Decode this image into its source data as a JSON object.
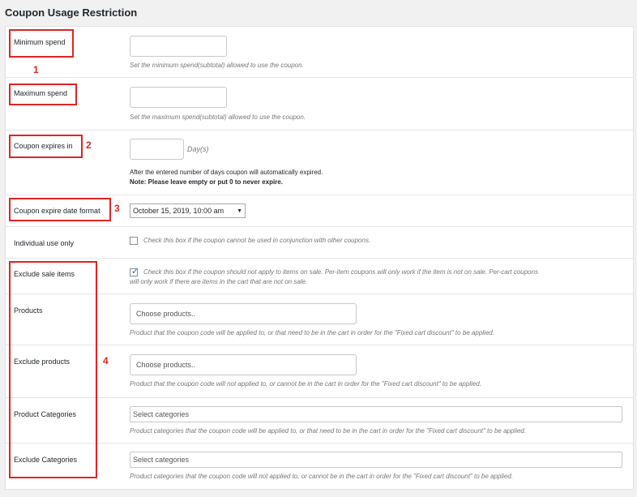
{
  "section_title": "Coupon Usage Restriction",
  "min_spend": {
    "label": "Minimum spend",
    "value": "",
    "help": "Set the minimum spend(subtotal) allowed to use the coupon."
  },
  "max_spend": {
    "label": "Maximum spend",
    "value": "",
    "help": "Set the maximum spend(subtotal) allowed to use the coupon."
  },
  "expires_in": {
    "label": "Coupon expires in",
    "value": "",
    "unit": "Day(s)",
    "help": "After the entered number of days coupon will automatically expired.",
    "note": "Note: Please leave empty or put 0 to never expire."
  },
  "date_format": {
    "label": "Coupon expire date format",
    "selected": "October 15, 2019, 10:00 am"
  },
  "individual_use": {
    "label": "Individual use only",
    "help": "Check this box if the coupon cannot be used in conjunction with other coupons.",
    "checked": false
  },
  "exclude_sale": {
    "label": "Exclude sale items",
    "help_line1": "Check this box if the coupon should not apply to items on sale. Per-item coupons will only work if the item is not on sale. Per-cart coupons",
    "help_line2": "will only work if there are items in the cart that are not on sale.",
    "checked": true
  },
  "products": {
    "label": "Products",
    "placeholder": "Choose products..",
    "help": "Product that the coupon code will be applied to, or that need to be in the cart in order for the \"Fixed cart discount\" to be applied."
  },
  "exclude_products": {
    "label": "Exclude products",
    "placeholder": "Choose products..",
    "help": "Product that the coupon code will not applied to, or cannot be in the cart in order for the \"Fixed cart discount\" to be applied."
  },
  "product_categories": {
    "label": "Product Categories",
    "placeholder": "Select categories",
    "help": "Product categories that the coupon code will be applied to, or that need to be in the cart in order for the \"Fixed cart discount\" to be applied."
  },
  "exclude_categories": {
    "label": "Exclude Categories",
    "placeholder": "Select categories",
    "help": "Product categories that the coupon code will not applied to, or cannot be in the cart in order for the \"Fixed cart discount\" to be applied."
  },
  "markers": {
    "m1": "1",
    "m2": "2",
    "m3": "3",
    "m4": "4"
  },
  "colors": {
    "annotation_red": "#e02424",
    "checkbox_blue": "#2271b1"
  }
}
